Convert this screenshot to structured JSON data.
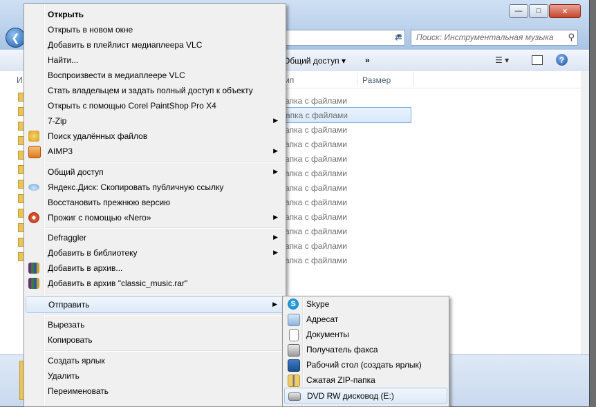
{
  "explorer": {
    "search_placeholder": "Поиск: Инструментальная музыка",
    "toolbar_share": "Общий доступ ▾",
    "toolbar_more": "»",
    "left_header": "И",
    "col_type": "ип",
    "col_size": "Размер",
    "rows": [
      "апка с файлами",
      "апка с файлами",
      "апка с файлами",
      "апка с файлами",
      "апка с файлами",
      "апка с файлами",
      "апка с файлами",
      "апка с файлами",
      "апка с файлами",
      "апка с файлами",
      "апка с файлами",
      "апка с файлами"
    ],
    "selected_row_index": 1
  },
  "context_menu": {
    "items": [
      {
        "label": "Открыть",
        "bold": true
      },
      {
        "label": "Открыть в новом окне"
      },
      {
        "label": "Добавить в плейлист медиаплеера VLC"
      },
      {
        "label": "Найти..."
      },
      {
        "label": "Воспроизвести в медиаплеере VLC"
      },
      {
        "label": "Стать владельцем и задать полный доступ к объекту"
      },
      {
        "label": "Открыть с помощью Corel PaintShop Pro X4"
      },
      {
        "label": "7-Zip",
        "submenu": true
      },
      {
        "label": "Поиск удалённых файлов",
        "icon": "search-files-icon"
      },
      {
        "label": "AIMP3",
        "submenu": true,
        "icon": "aimp-icon"
      },
      {
        "label": "Общий доступ",
        "submenu": true
      },
      {
        "label": "Яндекс.Диск: Скопировать публичную ссылку",
        "icon": "yandex-disk-icon"
      },
      {
        "label": "Восстановить прежнюю версию"
      },
      {
        "label": "Прожиг с помощью «Nero»",
        "submenu": true,
        "icon": "nero-icon"
      },
      {
        "label": "Defraggler",
        "submenu": true
      },
      {
        "label": "Добавить в библиотеку",
        "submenu": true
      },
      {
        "label": "Добавить в архив...",
        "icon": "winrar-icon"
      },
      {
        "label": "Добавить в архив \"classic_music.rar\"",
        "icon": "winrar-icon"
      },
      {
        "label": "Отправить",
        "submenu": true,
        "highlighted": true
      },
      {
        "label": "Вырезать"
      },
      {
        "label": "Копировать"
      },
      {
        "label": "Создать ярлык"
      },
      {
        "label": "Удалить"
      },
      {
        "label": "Переименовать"
      }
    ]
  },
  "send_to_menu": {
    "items": [
      {
        "label": "Skype",
        "icon": "skype-icon"
      },
      {
        "label": "Адресат",
        "icon": "mail-recipient-icon"
      },
      {
        "label": "Документы",
        "icon": "documents-icon"
      },
      {
        "label": "Получатель факса",
        "icon": "fax-icon"
      },
      {
        "label": "Рабочий стол (создать ярлык)",
        "icon": "desktop-icon"
      },
      {
        "label": "Сжатая ZIP-папка",
        "icon": "zip-folder-icon"
      },
      {
        "label": "DVD RW дисковод (E:)",
        "icon": "dvd-drive-icon",
        "highlighted": true
      }
    ]
  }
}
